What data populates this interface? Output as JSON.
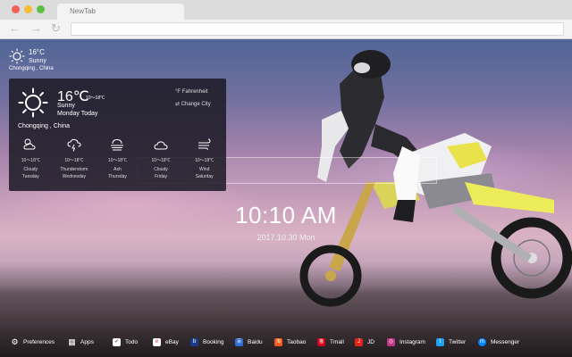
{
  "browser": {
    "tab_title": "NewTab"
  },
  "weather_mini": {
    "temp": "16°C",
    "condition": "Sunny",
    "location": "Chongqing , China"
  },
  "weather_panel": {
    "temp": "16℃",
    "range": "10～18℃",
    "condition": "Sunny",
    "day": "Monday Today",
    "location": "Chongqing , China",
    "unit_option": "Fahrenheit",
    "city_option": "Change City",
    "unit_icon": "°F",
    "city_icon": "⇄",
    "forecast": [
      {
        "icon": "cloudy-sun-icon",
        "range": "10～18℃",
        "condition": "Cloudy",
        "day": "Tuesday"
      },
      {
        "icon": "thunderstorm-icon",
        "range": "10～18℃",
        "condition": "Thunderstorm",
        "day": "Wednesday"
      },
      {
        "icon": "ash-icon",
        "range": "10～18℃",
        "condition": "Ash",
        "day": "Thursday"
      },
      {
        "icon": "cloud-icon",
        "range": "10～18℃",
        "condition": "Cloudy",
        "day": "Friday"
      },
      {
        "icon": "wind-icon",
        "range": "10～18℃",
        "condition": "Wind",
        "day": "Saturday"
      }
    ]
  },
  "clock": {
    "time": "10:10 AM",
    "date": "2017.10.30 Mon"
  },
  "bottom_bar": [
    {
      "label": "Preferences",
      "icon": "gear-icon",
      "color": "#000000",
      "glyph": "⚙"
    },
    {
      "label": "Apps",
      "icon": "grid-icon",
      "color": "#000000",
      "glyph": "▦"
    },
    {
      "label": "Todo",
      "icon": "checkbox-icon",
      "color": "#ffffff",
      "glyph": "✓"
    },
    {
      "label": "eBay",
      "icon": "ebay-icon",
      "color": "#ffffff",
      "glyph": "e"
    },
    {
      "label": "Booking",
      "icon": "booking-icon",
      "color": "#1a3b8c",
      "glyph": "b"
    },
    {
      "label": "Baidu",
      "icon": "baidu-icon",
      "color": "#2f6fd6",
      "glyph": "百"
    },
    {
      "label": "Taobao",
      "icon": "taobao-icon",
      "color": "#f05a1a",
      "glyph": "淘"
    },
    {
      "label": "Tmall",
      "icon": "tmall-icon",
      "color": "#d6001c",
      "glyph": "猫"
    },
    {
      "label": "JD",
      "icon": "jd-icon",
      "color": "#e1251b",
      "glyph": "J"
    },
    {
      "label": "Instagram",
      "icon": "instagram-icon",
      "color": "#c13584",
      "glyph": "◎"
    },
    {
      "label": "Twitter",
      "icon": "twitter-icon",
      "color": "#1da1f2",
      "glyph": "t"
    },
    {
      "label": "Messenger",
      "icon": "messenger-icon",
      "color": "#0084ff",
      "glyph": "m"
    }
  ]
}
